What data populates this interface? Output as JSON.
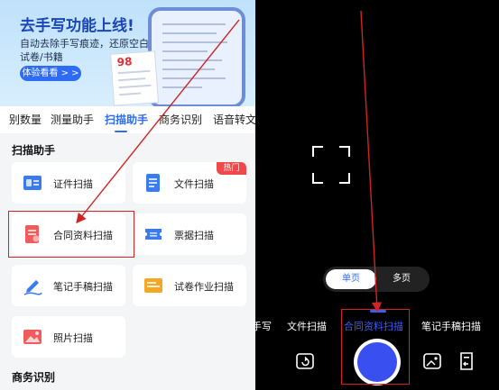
{
  "banner": {
    "title": "去手写功能上线!",
    "subtitle": "自动去除手写痕迹，还原空白试卷/书籍",
    "button_label": "体验看看 > >",
    "score": "98"
  },
  "tabs": [
    {
      "label": "别数量",
      "active": false
    },
    {
      "label": "测量助手",
      "active": false
    },
    {
      "label": "扫描助手",
      "active": true
    },
    {
      "label": "商务识别",
      "active": false
    },
    {
      "label": "语音转文",
      "active": false
    }
  ],
  "scan_section": {
    "title": "扫描助手",
    "items": [
      {
        "label": "证件扫描",
        "icon": "id-card-icon",
        "badge": ""
      },
      {
        "label": "文件扫描",
        "icon": "document-icon",
        "badge": "热门"
      },
      {
        "label": "合同资料扫描",
        "icon": "contract-icon",
        "badge": ""
      },
      {
        "label": "票据扫描",
        "icon": "ticket-icon",
        "badge": ""
      },
      {
        "label": "笔记手稿扫描",
        "icon": "pen-icon",
        "badge": ""
      },
      {
        "label": "试卷作业扫描",
        "icon": "exam-paper-icon",
        "badge": ""
      },
      {
        "label": "照片扫描",
        "icon": "photo-icon",
        "badge": ""
      }
    ]
  },
  "business_section": {
    "title": "商务识别"
  },
  "camera": {
    "segment": [
      {
        "label": "单页",
        "active": true
      },
      {
        "label": "多页",
        "active": false
      }
    ],
    "modes": [
      {
        "label": "手写",
        "active": false
      },
      {
        "label": "文件扫描",
        "active": false
      },
      {
        "label": "合同资料扫描",
        "active": true
      },
      {
        "label": "笔记手稿扫描",
        "active": false
      }
    ],
    "left_tool_icon": "rotate-camera-icon",
    "right_tool_icons": [
      "gallery-icon",
      "import-icon"
    ]
  },
  "colors": {
    "accent": "#2f6cf6",
    "annotation": "#d32222",
    "shutter": "#3a4ff0",
    "hot_badge": "#f0484b"
  }
}
